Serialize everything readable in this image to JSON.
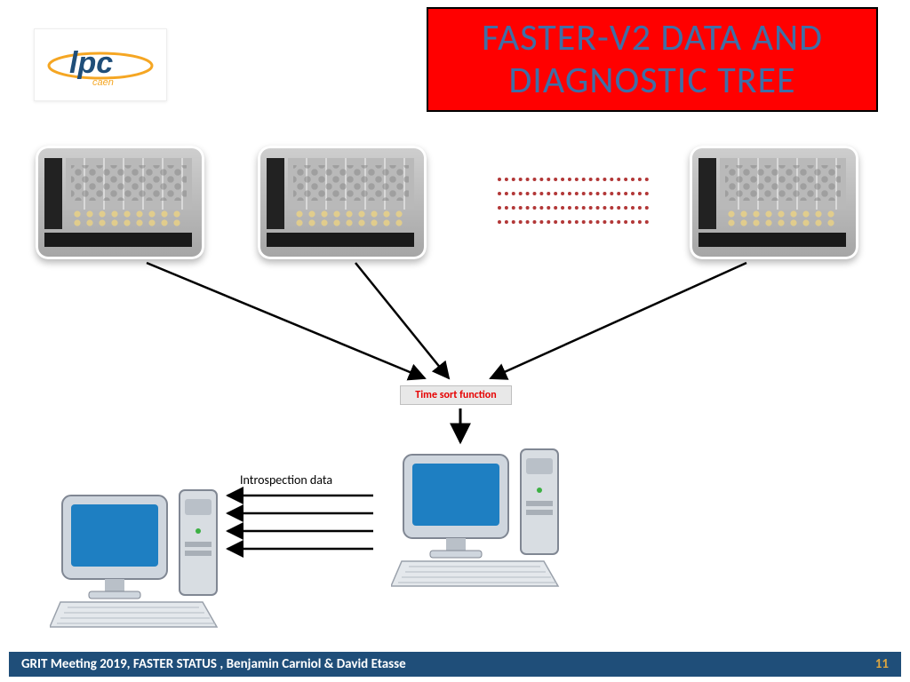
{
  "logo": {
    "name": "lpc-caen"
  },
  "title": "FASTER-V2 DATA AND DIAGNOSTIC  TREE",
  "timesort_label": "Time sort function",
  "introspection_label": "Introspection data",
  "footer": {
    "text": "GRIT Meeting 2019, FASTER STATUS , Benjamin Carniol & David Etasse",
    "page": "11"
  }
}
